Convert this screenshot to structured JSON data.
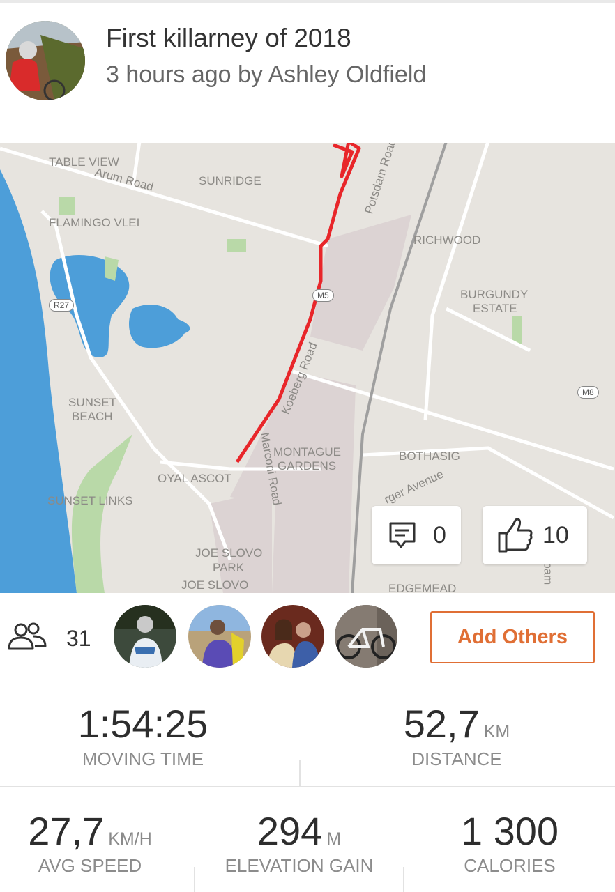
{
  "activity": {
    "title": "First killarney of 2018",
    "subtitle": "3 hours ago by Ashley Oldfield"
  },
  "map": {
    "labels": {
      "table_view": "TABLE VIEW",
      "arum_road": "Arum Road",
      "sunridge": "SUNRIDGE",
      "flamingo_vlei": "FLAMINGO VLEI",
      "potsdam_road": "Potsdam Road",
      "richwood": "RICHWOOD",
      "burgundy_estate_1": "BURGUNDY",
      "burgundy_estate_2": "ESTATE",
      "koeberg_road": "Koeberg Road",
      "sunset_beach_1": "SUNSET",
      "sunset_beach_2": "BEACH",
      "marconi_road": "Marconi Road",
      "montague_gardens_1": "MONTAGUE",
      "montague_gardens_2": "GARDENS",
      "bothasig": "BOTHASIG",
      "royal_ascot": "OYAL ASCOT",
      "burger_avenue": "rger Avenue",
      "sunset_links": "SUNSET LINKS",
      "joe_slovo_park_1": "JOE SLOVO",
      "joe_slovo_park_2": "PARK",
      "joe_slovo": "JOE SLOVO",
      "edgemead": "EDGEMEAD",
      "alabama": "abam"
    },
    "badges": {
      "r27": "R27",
      "m5": "M5",
      "m8": "M8"
    },
    "route_color": "#e8262a",
    "water_color": "#4d9ed9"
  },
  "social": {
    "comments": "0",
    "kudos": "10"
  },
  "athletes": {
    "count": "31",
    "add_label": "Add Others"
  },
  "stats": {
    "moving_time": {
      "value": "1:54:25",
      "label": "MOVING TIME"
    },
    "distance": {
      "value": "52,7",
      "unit": "KM",
      "label": "DISTANCE"
    },
    "avg_speed": {
      "value": "27,7",
      "unit": "KM/H",
      "label": "AVG SPEED"
    },
    "elevation": {
      "value": "294",
      "unit": "M",
      "label": "ELEVATION GAIN"
    },
    "calories": {
      "value": "1 300",
      "label": "CALORIES"
    }
  },
  "colors": {
    "accent": "#e06f35"
  }
}
